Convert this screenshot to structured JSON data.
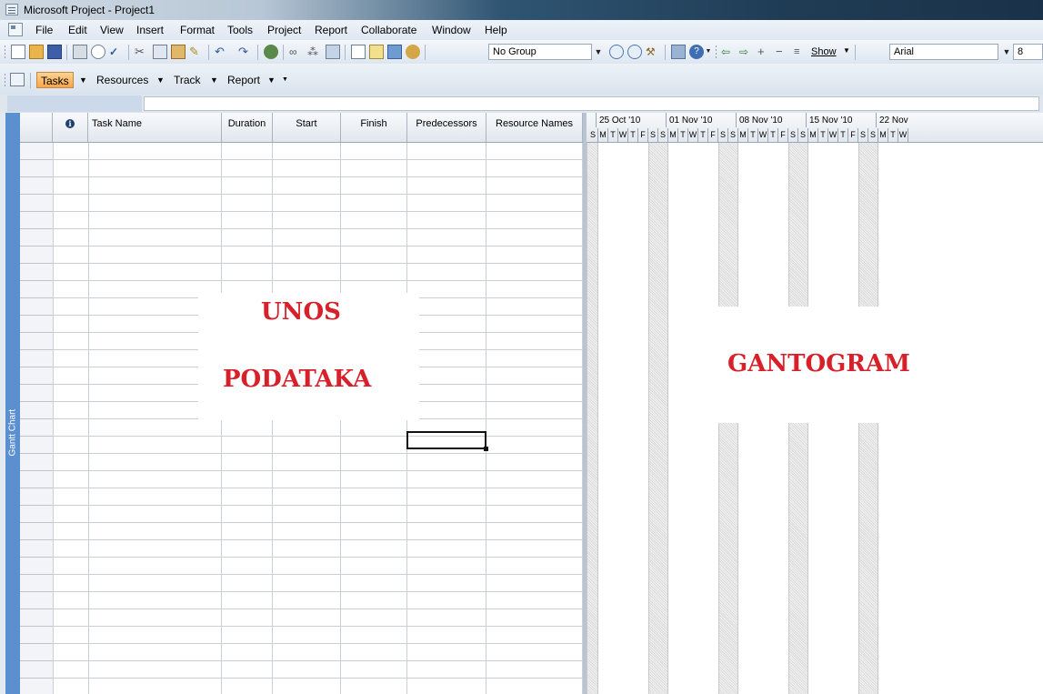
{
  "window": {
    "title": "Microsoft Project - Project1"
  },
  "menu": [
    "File",
    "Edit",
    "View",
    "Insert",
    "Format",
    "Tools",
    "Project",
    "Report",
    "Collaborate",
    "Window",
    "Help"
  ],
  "toolbar": {
    "group_value": "No Group",
    "show_label": "Show",
    "font_value": "Arial",
    "size_value": "8"
  },
  "guide": {
    "tasks": "Tasks",
    "resources": "Resources",
    "track": "Track",
    "report": "Report"
  },
  "view_bar": {
    "label": "Gantt Chart"
  },
  "table": {
    "columns": [
      "Task Name",
      "Duration",
      "Start",
      "Finish",
      "Predecessors",
      "Resource Names"
    ],
    "info_glyph": "i"
  },
  "timescale": {
    "weeks": [
      "25 Oct '10",
      "01 Nov '10",
      "08 Nov '10",
      "15 Nov '10",
      "22 Nov"
    ],
    "days": [
      "S",
      "M",
      "T",
      "W",
      "T",
      "F",
      "S",
      "S",
      "M",
      "T",
      "W",
      "T",
      "F",
      "S",
      "S",
      "M",
      "T",
      "W",
      "T",
      "F",
      "S",
      "S",
      "M",
      "T",
      "W",
      "T",
      "F",
      "S",
      "S",
      "M",
      "T",
      "W"
    ]
  },
  "annotations": {
    "left_line1": "UNOS",
    "left_line2": "PODATAKA",
    "right": "GANTOGRAM"
  },
  "colors": {
    "annotation": "#d8202a",
    "viewbar": "#5b8fcf",
    "active_tab": "#f8a648"
  }
}
